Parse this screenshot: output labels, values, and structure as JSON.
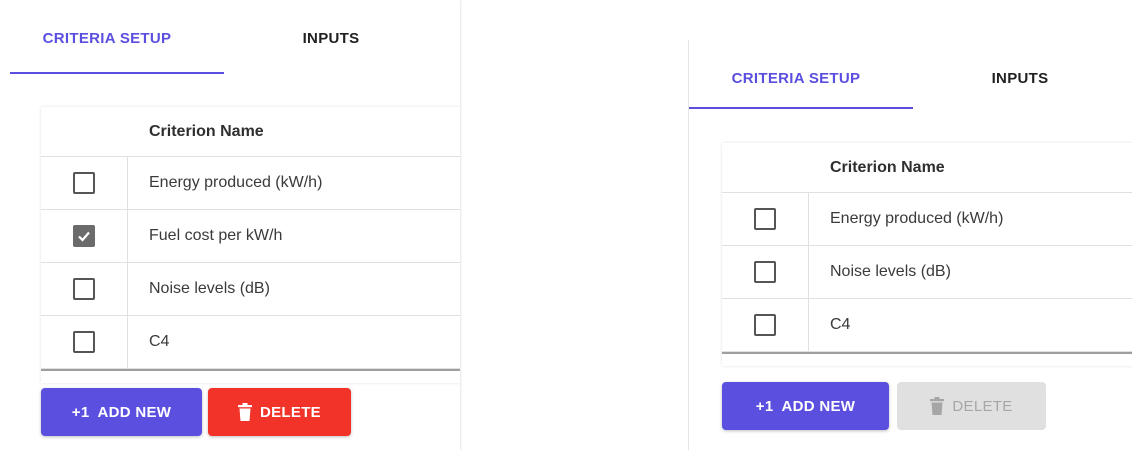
{
  "panels": [
    {
      "tabs": [
        {
          "label": "CRITERIA SETUP",
          "active": true
        },
        {
          "label": "INPUTS",
          "active": false
        }
      ],
      "table": {
        "header": {
          "name": "Criterion Name"
        },
        "rows": [
          {
            "name": "Energy produced (kW/h)",
            "checked": false
          },
          {
            "name": "Fuel cost per kW/h",
            "checked": true
          },
          {
            "name": "Noise levels (dB)",
            "checked": false
          },
          {
            "name": "C4",
            "checked": false
          }
        ]
      },
      "actions": {
        "add": {
          "icon": "+1",
          "label": "ADD NEW"
        },
        "delete": {
          "icon": "trash-icon",
          "label": "DELETE",
          "enabled": true
        }
      }
    },
    {
      "tabs": [
        {
          "label": "CRITERIA SETUP",
          "active": true
        },
        {
          "label": "INPUTS",
          "active": false
        }
      ],
      "table": {
        "header": {
          "name": "Criterion Name"
        },
        "rows": [
          {
            "name": "Energy produced (kW/h)",
            "checked": false
          },
          {
            "name": "Noise levels (dB)",
            "checked": false
          },
          {
            "name": "C4",
            "checked": false
          }
        ]
      },
      "actions": {
        "add": {
          "icon": "+1",
          "label": "ADD NEW"
        },
        "delete": {
          "icon": "trash-icon",
          "label": "DELETE",
          "enabled": false
        }
      }
    }
  ],
  "colors": {
    "accent": "#5b4fe0",
    "danger": "#f2332a",
    "disabled_bg": "#e0e0e0",
    "disabled_text": "#a6a6a6"
  }
}
